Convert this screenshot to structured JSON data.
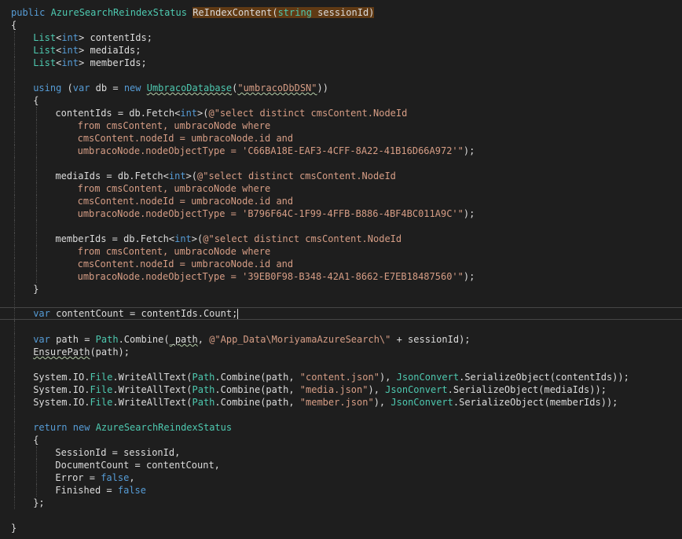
{
  "editor": {
    "lines": [
      {
        "i": 0,
        "tokens": [
          [
            "kw",
            "public "
          ],
          [
            "ty",
            "AzureSearchReindexStatus"
          ],
          [
            "tx",
            " "
          ],
          [
            "hl",
            "ReIndexContent("
          ],
          [
            "hlty",
            "string"
          ],
          [
            "hl",
            " sessionId)"
          ]
        ]
      },
      {
        "i": 0,
        "tokens": [
          [
            "tx",
            "{"
          ]
        ]
      },
      {
        "i": 1,
        "tokens": [
          [
            "ty",
            "List"
          ],
          [
            "tx",
            "<"
          ],
          [
            "kw",
            "int"
          ],
          [
            "tx",
            "> contentIds;"
          ]
        ]
      },
      {
        "i": 1,
        "tokens": [
          [
            "ty",
            "List"
          ],
          [
            "tx",
            "<"
          ],
          [
            "kw",
            "int"
          ],
          [
            "tx",
            "> mediaIds;"
          ]
        ]
      },
      {
        "i": 1,
        "tokens": [
          [
            "ty",
            "List"
          ],
          [
            "tx",
            "<"
          ],
          [
            "kw",
            "int"
          ],
          [
            "tx",
            "> memberIds;"
          ]
        ]
      },
      {
        "i": 1,
        "tokens": []
      },
      {
        "i": 1,
        "tokens": [
          [
            "kw",
            "using"
          ],
          [
            "tx",
            " ("
          ],
          [
            "kw",
            "var"
          ],
          [
            "tx",
            " db = "
          ],
          [
            "kw",
            "new"
          ],
          [
            "tx",
            " "
          ],
          [
            "tysq",
            "UmbracoDatabase"
          ],
          [
            "tx",
            "("
          ],
          [
            "strsq",
            "\"umbracoDbDSN\""
          ],
          [
            "tx",
            "))"
          ]
        ]
      },
      {
        "i": 1,
        "tokens": [
          [
            "tx",
            "{"
          ]
        ]
      },
      {
        "i": 2,
        "tokens": [
          [
            "tx",
            "contentIds = db.Fetch<"
          ],
          [
            "kw",
            "int"
          ],
          [
            "tx",
            ">("
          ],
          [
            "str",
            "@\"select distinct cmsContent.NodeId"
          ]
        ]
      },
      {
        "i": 2,
        "cont": 1,
        "tokens": [
          [
            "str",
            "from cmsContent, umbracoNode where"
          ]
        ]
      },
      {
        "i": 2,
        "cont": 1,
        "tokens": [
          [
            "str",
            "cmsContent.nodeId = umbracoNode.id and"
          ]
        ]
      },
      {
        "i": 2,
        "cont": 1,
        "tokens": [
          [
            "str",
            "umbracoNode.nodeObjectType = 'C66BA18E-EAF3-4CFF-8A22-41B16D66A972'\""
          ],
          [
            "tx",
            ");"
          ]
        ]
      },
      {
        "i": 2,
        "tokens": []
      },
      {
        "i": 2,
        "tokens": [
          [
            "tx",
            "mediaIds = db.Fetch<"
          ],
          [
            "kw",
            "int"
          ],
          [
            "tx",
            ">("
          ],
          [
            "str",
            "@\"select distinct cmsContent.NodeId"
          ]
        ]
      },
      {
        "i": 2,
        "cont": 1,
        "tokens": [
          [
            "str",
            "from cmsContent, umbracoNode where"
          ]
        ]
      },
      {
        "i": 2,
        "cont": 1,
        "tokens": [
          [
            "str",
            "cmsContent.nodeId = umbracoNode.id and"
          ]
        ]
      },
      {
        "i": 2,
        "cont": 1,
        "tokens": [
          [
            "str",
            "umbracoNode.nodeObjectType = 'B796F64C-1F99-4FFB-B886-4BF4BC011A9C'\""
          ],
          [
            "tx",
            ");"
          ]
        ]
      },
      {
        "i": 2,
        "tokens": []
      },
      {
        "i": 2,
        "tokens": [
          [
            "tx",
            "memberIds = db.Fetch<"
          ],
          [
            "kw",
            "int"
          ],
          [
            "tx",
            ">("
          ],
          [
            "str",
            "@\"select distinct cmsContent.NodeId"
          ]
        ]
      },
      {
        "i": 2,
        "cont": 1,
        "tokens": [
          [
            "str",
            "from cmsContent, umbracoNode where"
          ]
        ]
      },
      {
        "i": 2,
        "cont": 1,
        "tokens": [
          [
            "str",
            "cmsContent.nodeId = umbracoNode.id and"
          ]
        ]
      },
      {
        "i": 2,
        "cont": 1,
        "tokens": [
          [
            "str",
            "umbracoNode.nodeObjectType = '39EB0F98-B348-42A1-8662-E7EB18487560'\""
          ],
          [
            "tx",
            ");"
          ]
        ]
      },
      {
        "i": 1,
        "tokens": [
          [
            "tx",
            "}"
          ]
        ]
      },
      {
        "i": 1,
        "tokens": []
      },
      {
        "i": 1,
        "current": true,
        "tokens": [
          [
            "kw",
            "var"
          ],
          [
            "tx",
            " contentCount = contentIds.Count;"
          ]
        ]
      },
      {
        "i": 1,
        "tokens": []
      },
      {
        "i": 1,
        "tokens": [
          [
            "kw",
            "var"
          ],
          [
            "tx",
            " path = "
          ],
          [
            "ty",
            "Path"
          ],
          [
            "tx",
            ".Combine("
          ],
          [
            "tysq2",
            "_path"
          ],
          [
            "tx",
            ", "
          ],
          [
            "str",
            "@\"App_Data\\MoriyamaAzureSearch\\\""
          ],
          [
            "tx",
            " + sessionId);"
          ]
        ]
      },
      {
        "i": 1,
        "tokens": [
          [
            "tysq2",
            "EnsurePath"
          ],
          [
            "tx",
            "(path);"
          ]
        ]
      },
      {
        "i": 1,
        "tokens": []
      },
      {
        "i": 1,
        "tokens": [
          [
            "tx",
            "System.IO."
          ],
          [
            "ty",
            "File"
          ],
          [
            "tx",
            ".WriteAllText("
          ],
          [
            "ty",
            "Path"
          ],
          [
            "tx",
            ".Combine(path, "
          ],
          [
            "str",
            "\"content.json\""
          ],
          [
            "tx",
            "), "
          ],
          [
            "ty",
            "JsonConvert"
          ],
          [
            "tx",
            ".SerializeObject(contentIds));"
          ]
        ]
      },
      {
        "i": 1,
        "tokens": [
          [
            "tx",
            "System.IO."
          ],
          [
            "ty",
            "File"
          ],
          [
            "tx",
            ".WriteAllText("
          ],
          [
            "ty",
            "Path"
          ],
          [
            "tx",
            ".Combine(path, "
          ],
          [
            "str",
            "\"media.json\""
          ],
          [
            "tx",
            "), "
          ],
          [
            "ty",
            "JsonConvert"
          ],
          [
            "tx",
            ".SerializeObject(mediaIds));"
          ]
        ]
      },
      {
        "i": 1,
        "tokens": [
          [
            "tx",
            "System.IO."
          ],
          [
            "ty",
            "File"
          ],
          [
            "tx",
            ".WriteAllText("
          ],
          [
            "ty",
            "Path"
          ],
          [
            "tx",
            ".Combine(path, "
          ],
          [
            "str",
            "\"member.json\""
          ],
          [
            "tx",
            "), "
          ],
          [
            "ty",
            "JsonConvert"
          ],
          [
            "tx",
            ".SerializeObject(memberIds));"
          ]
        ]
      },
      {
        "i": 1,
        "tokens": []
      },
      {
        "i": 1,
        "tokens": [
          [
            "kw",
            "return"
          ],
          [
            "tx",
            " "
          ],
          [
            "kw",
            "new"
          ],
          [
            "tx",
            " "
          ],
          [
            "ty",
            "AzureSearchReindexStatus"
          ]
        ]
      },
      {
        "i": 1,
        "tokens": [
          [
            "tx",
            "{"
          ]
        ]
      },
      {
        "i": 2,
        "tokens": [
          [
            "tx",
            "SessionId = sessionId,"
          ]
        ]
      },
      {
        "i": 2,
        "tokens": [
          [
            "tx",
            "DocumentCount = contentCount,"
          ]
        ]
      },
      {
        "i": 2,
        "tokens": [
          [
            "tx",
            "Error = "
          ],
          [
            "kw",
            "false"
          ],
          [
            "tx",
            ","
          ]
        ]
      },
      {
        "i": 2,
        "tokens": [
          [
            "tx",
            "Finished = "
          ],
          [
            "kw",
            "false"
          ]
        ]
      },
      {
        "i": 1,
        "tokens": [
          [
            "tx",
            "};"
          ]
        ]
      },
      {
        "i": 0,
        "tokens": []
      },
      {
        "i": 0,
        "tokens": [
          [
            "tx",
            "}"
          ]
        ]
      }
    ]
  },
  "colors": {
    "background": "#1e1e1e",
    "keyword": "#569cd6",
    "type": "#4ec9b0",
    "string": "#d69d85",
    "text": "#dcdcdc",
    "highlight": "#603a14"
  }
}
